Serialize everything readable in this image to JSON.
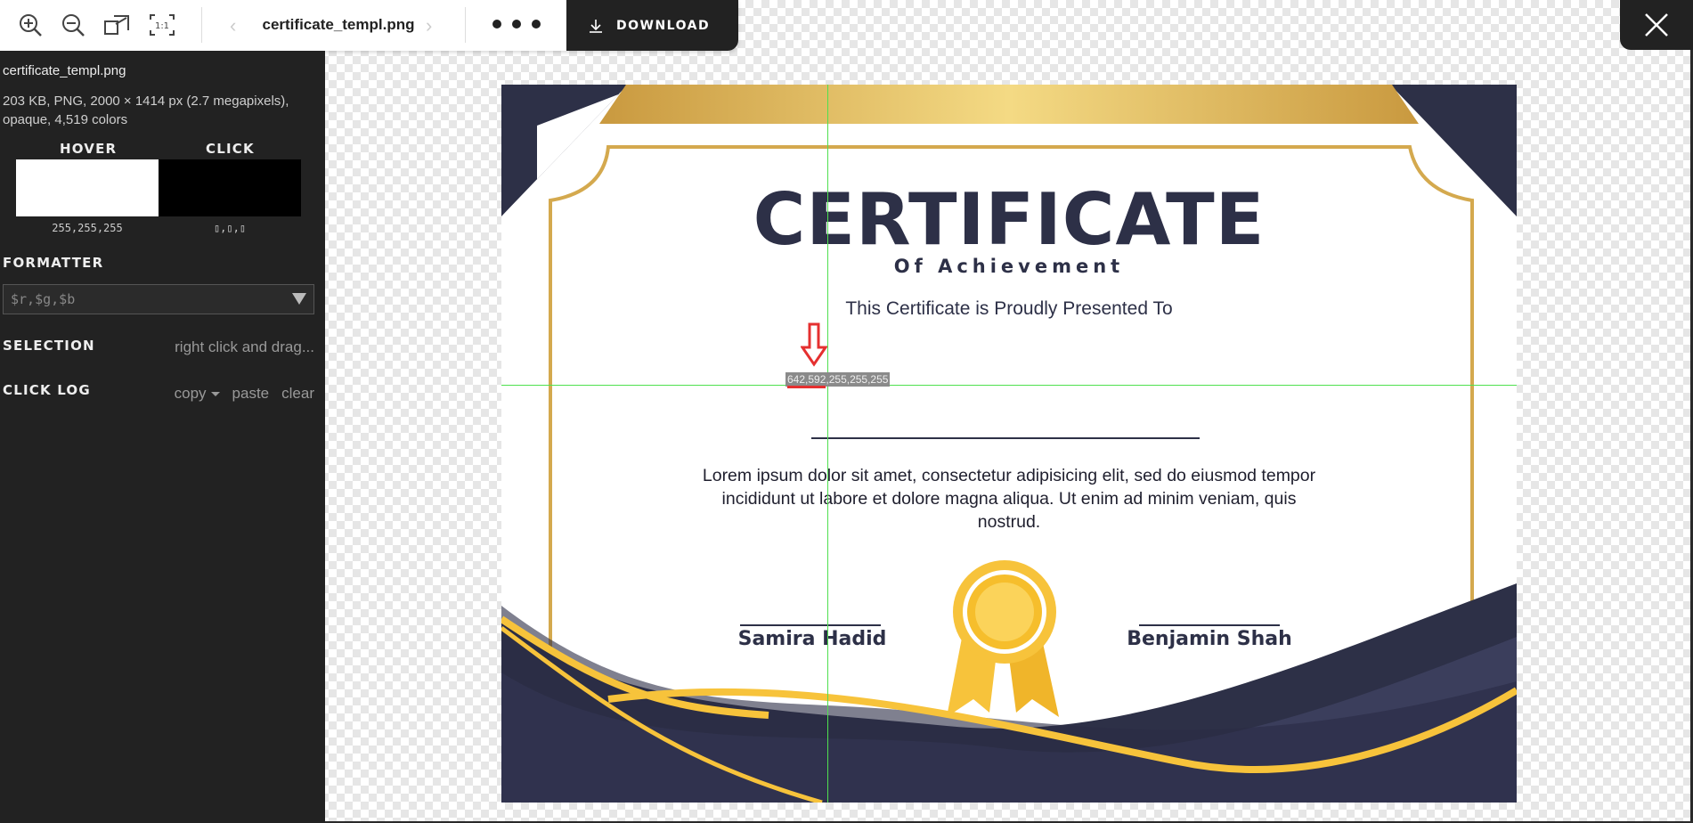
{
  "toolbar": {
    "filename": "certificate_templ.png",
    "download_label": "DOWNLOAD",
    "zoom_in_icon": "zoom-in-icon",
    "zoom_out_icon": "zoom-out-icon",
    "fit_icon": "fit-to-window-icon",
    "actual_size_icon": "actual-size-icon",
    "prev_icon": "chevron-left-icon",
    "next_icon": "chevron-right-icon",
    "more_icon": "more-dots-icon",
    "close_icon": "close-icon"
  },
  "sidebar": {
    "filename": "certificate_templ.png",
    "meta": "203 KB, PNG, 2000 × 1414 px (2.7 megapixels), opaque, 4,519 colors",
    "hover_label": "HOVER",
    "click_label": "CLICK",
    "hover_color": "#ffffff",
    "click_color": "#000000",
    "hover_value": "255,255,255",
    "click_value": "▯,▯,▯",
    "formatter_label": "FORMATTER",
    "formatter_placeholder": "$r,$g,$b",
    "selection_label": "SELECTION",
    "selection_hint": "right click and drag...",
    "clicklog_label": "CLICK LOG",
    "copy_label": "copy",
    "paste_label": "paste",
    "clear_label": "clear"
  },
  "certificate": {
    "title": "CERTIFICATE",
    "subtitle": "Of Achievement",
    "presented": "This Certificate is Proudly Presented To",
    "body": "Lorem ipsum dolor sit amet, consectetur adipisicing elit, sed do eiusmod tempor incididunt ut labore et dolore magna aliqua. Ut enim ad minim veniam, quis nostrud.",
    "signer_left": "Samira Hadid",
    "signer_right": "Benjamin Shah",
    "navy": "#2d3047",
    "gold": "#d4a94e",
    "yellow": "#f7c33b"
  },
  "overlay": {
    "coords": "642,592",
    "rgb": ",255,255,255",
    "crosshair_color": "#4fe04f",
    "arrow_color": "#e53030"
  }
}
